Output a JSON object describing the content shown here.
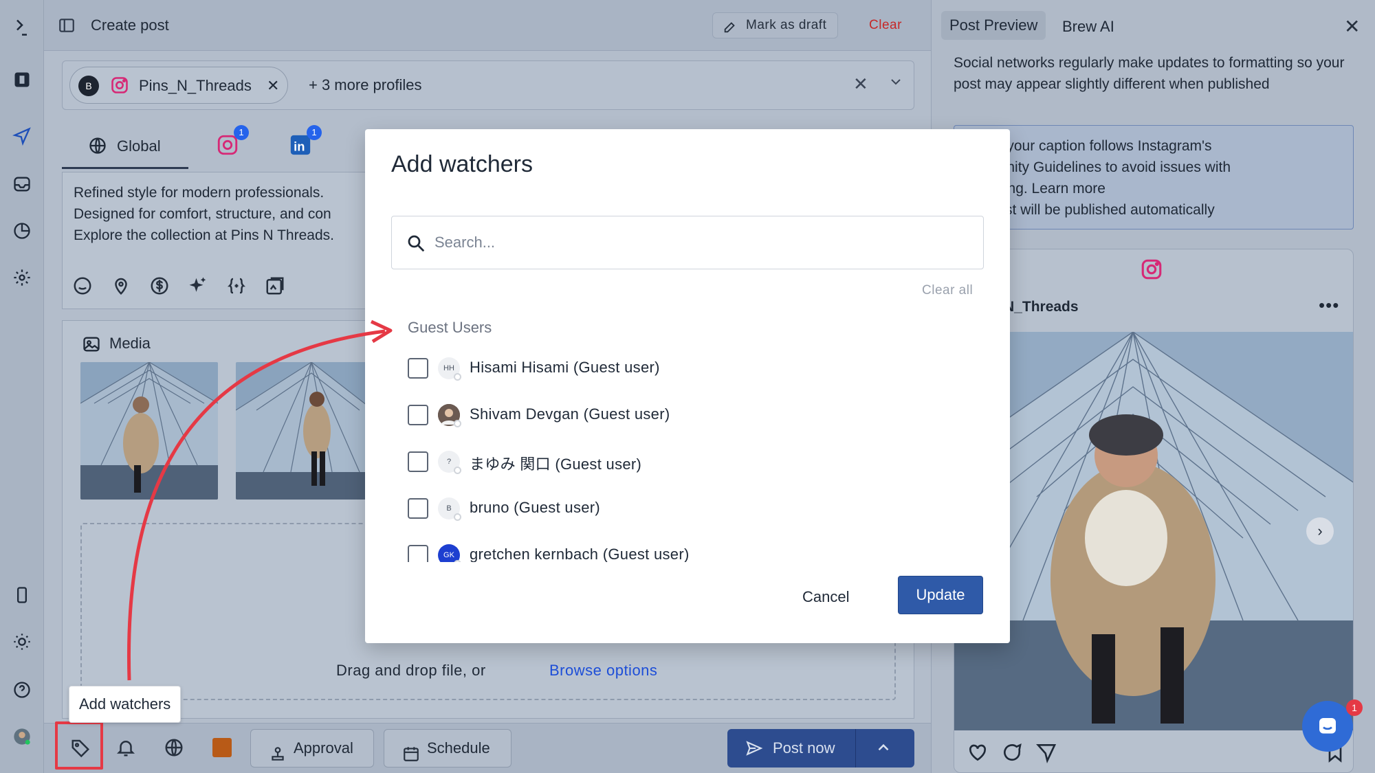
{
  "header": {
    "title": "Create post",
    "mark_draft": "Mark as draft",
    "clear": "Clear"
  },
  "profiles": {
    "chip_name": "Pins_N_Threads",
    "chip_avatar": "B",
    "more": "+ 3 more profiles"
  },
  "tabs": {
    "global": "Global",
    "instagram_badge": "1",
    "linkedin_badge": "1"
  },
  "caption": {
    "text": "Refined style for modern professionals.\nDesigned for comfort, structure, and con\nExplore the collection at Pins N Threads."
  },
  "media": {
    "title": "Media",
    "drop_text": "Drag and drop file, or",
    "browse": "Browse options"
  },
  "footer": {
    "approval": "Approval",
    "schedule": "Schedule",
    "post_now": "Post now",
    "tooltip": "Add watchers"
  },
  "preview": {
    "tab_active": "Post Preview",
    "tab_other": "Brew AI",
    "note": "Social networks regularly make updates to formatting so your post may appear slightly different when published",
    "info": "nsure your caption follows Instagram's\nommunity Guidelines to avoid issues with\nublishing. Learn more\nhis post will be published automatically",
    "account": "ins_N_Threads",
    "more": "•••",
    "next": "›",
    "chat_badge": "1"
  },
  "modal": {
    "title": "Add watchers",
    "search_placeholder": "Search...",
    "clear_all": "Clear all",
    "group": "Guest Users",
    "users": [
      {
        "name": "Hisami Hisami (Guest user)",
        "initials": "HH"
      },
      {
        "name": "Shivam Devgan (Guest user)",
        "initials": ""
      },
      {
        "name": "まゆみ 関口 (Guest user)",
        "initials": "?"
      },
      {
        "name": "bruno (Guest user)",
        "initials": "B"
      },
      {
        "name": "gretchen kernbach (Guest user)",
        "initials": "GK"
      }
    ],
    "cancel": "Cancel",
    "update": "Update"
  },
  "colors": {
    "accent": "#2f5aa8",
    "danger": "#c62828",
    "highlight": "#e53945",
    "swatch": "#b85a17"
  },
  "icons": [
    "logo-icon",
    "book-icon",
    "send-icon",
    "inbox-icon",
    "analytics-icon",
    "settings-icon",
    "mobile-icon",
    "sun-icon",
    "help-icon",
    "avatar",
    "panel-toggle-icon",
    "draft-icon",
    "instagram-icon",
    "linkedin-icon",
    "globe-icon",
    "emoji-icon",
    "location-icon",
    "dollar-icon",
    "sparkle-icon",
    "variable-icon",
    "ai-image-icon",
    "image-icon",
    "tag-icon",
    "bell-icon",
    "user-approval-icon",
    "calendar-icon",
    "send-icon",
    "chevron-up-icon",
    "close-icon",
    "search-icon",
    "heart-icon",
    "comment-icon",
    "share-icon",
    "bookmark-icon",
    "chat-icon"
  ]
}
